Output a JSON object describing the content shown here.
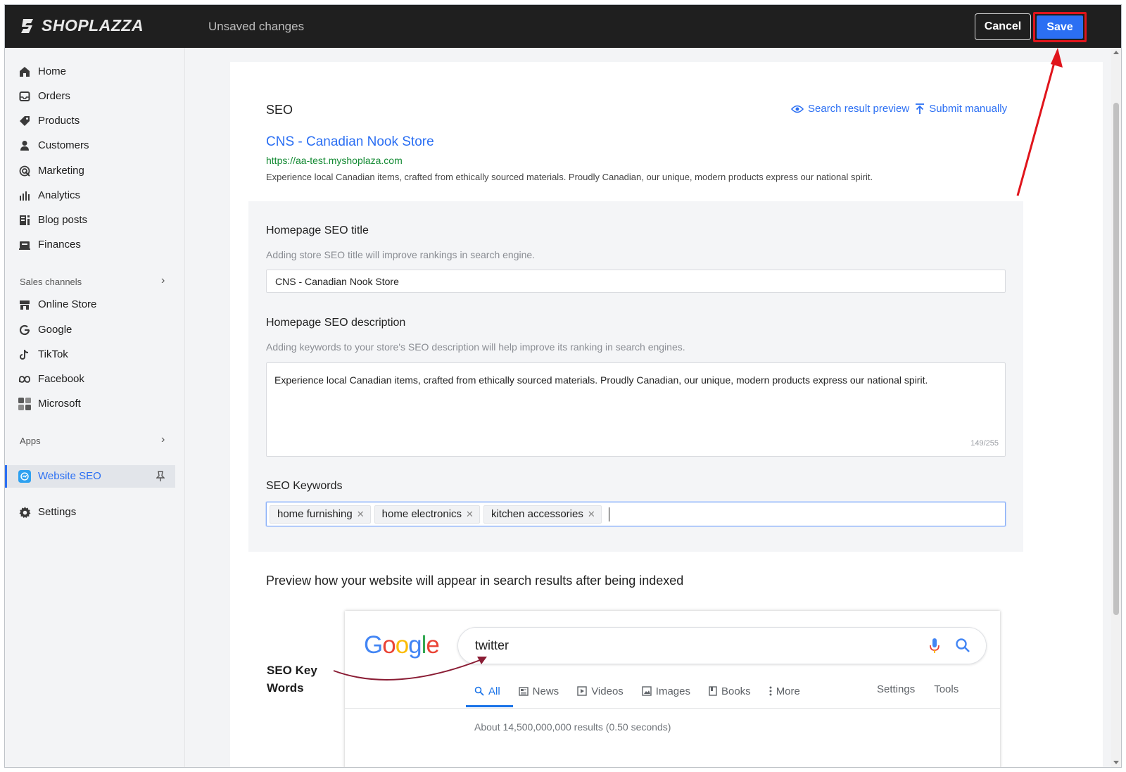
{
  "topbar": {
    "brand": "SHOPLAZZA",
    "status": "Unsaved changes",
    "cancel_label": "Cancel",
    "save_label": "Save"
  },
  "sidebar": {
    "main_items": [
      {
        "label": "Home",
        "icon": "home-icon"
      },
      {
        "label": "Orders",
        "icon": "inbox-icon"
      },
      {
        "label": "Products",
        "icon": "tag-icon"
      },
      {
        "label": "Customers",
        "icon": "person-icon"
      },
      {
        "label": "Marketing",
        "icon": "target-icon"
      },
      {
        "label": "Analytics",
        "icon": "bar-chart-icon"
      },
      {
        "label": "Blog posts",
        "icon": "blog-icon"
      },
      {
        "label": "Finances",
        "icon": "finance-icon"
      }
    ],
    "sales_channels_label": "Sales channels",
    "channel_items": [
      {
        "label": "Online Store",
        "icon": "store-icon"
      },
      {
        "label": "Google",
        "icon": "google-g-icon"
      },
      {
        "label": "TikTok",
        "icon": "tiktok-icon"
      },
      {
        "label": "Facebook",
        "icon": "meta-icon"
      },
      {
        "label": "Microsoft",
        "icon": "windows-icon"
      }
    ],
    "apps_label": "Apps",
    "app_items": [
      {
        "label": "Website SEO",
        "icon": "seo-app-icon",
        "active": true
      }
    ],
    "settings_label": "Settings"
  },
  "seo": {
    "heading": "SEO",
    "preview_link": "Search result preview",
    "submit_link": "Submit manually",
    "serp_title": "CNS - Canadian Nook Store",
    "serp_url": "https://aa-test.myshoplaza.com",
    "serp_description": "Experience local Canadian items, crafted from ethically sourced materials. Proudly Canadian, our unique, modern products express our national spirit."
  },
  "form": {
    "title_label": "Homepage SEO title",
    "title_help": "Adding store SEO title will improve rankings in search engine.",
    "title_value": "CNS - Canadian Nook Store",
    "description_label": "Homepage SEO description",
    "description_help": "Adding keywords to your store's SEO description will help improve its ranking in search engines.",
    "description_value": "Experience local Canadian items, crafted from ethically sourced materials. Proudly Canadian, our unique, modern products express our national spirit.",
    "description_counter": "149/255",
    "keywords_label": "SEO Keywords",
    "keywords": [
      "home furnishing",
      "home electronics",
      "kitchen accessories"
    ]
  },
  "preview": {
    "heading": "Preview how your website will appear in search results after being indexed",
    "annotation": "SEO Key Words",
    "google_logo": "Google",
    "query": "twitter",
    "tabs": [
      "All",
      "News",
      "Videos",
      "Images",
      "Books",
      "More"
    ],
    "right_tabs": [
      "Settings",
      "Tools"
    ],
    "results_text": "About 14,500,000,000 results (0.50 seconds)"
  },
  "colors": {
    "accent": "#2b6ff3",
    "topbar": "#1f1f1f",
    "highlight": "#e0151c",
    "url_green": "#138a33"
  }
}
